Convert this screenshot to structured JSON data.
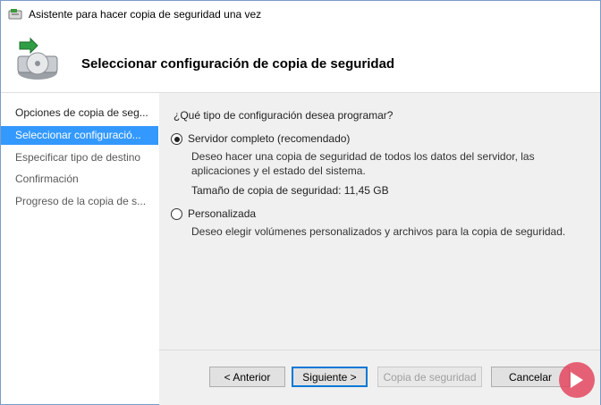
{
  "window": {
    "title": "Asistente para hacer copia de seguridad una vez"
  },
  "header": {
    "title": "Seleccionar configuración de copia de seguridad"
  },
  "sidebar": {
    "items": [
      {
        "label": "Opciones de copia de seg..."
      },
      {
        "label": "Seleccionar configuració..."
      },
      {
        "label": "Especificar tipo de destino"
      },
      {
        "label": "Confirmación"
      },
      {
        "label": "Progreso de la copia de s..."
      }
    ]
  },
  "main": {
    "question": "¿Qué tipo de configuración desea programar?",
    "options": [
      {
        "label": "Servidor completo (recomendado)",
        "description": "Deseo hacer una copia de seguridad de todos los datos del servidor, las aplicaciones y el estado del sistema.",
        "size_text": "Tamaño de copia de seguridad: 11,45 GB",
        "selected": true
      },
      {
        "label": "Personalizada",
        "description": "Deseo elegir volúmenes personalizados y archivos para la copia de seguridad.",
        "selected": false
      }
    ]
  },
  "buttons": {
    "back": "< Anterior",
    "next": "Siguiente >",
    "backup": "Copia de seguridad",
    "cancel": "Cancelar"
  },
  "colors": {
    "selection": "#3399ff",
    "accent": "#0078d7",
    "watermark": "#e4475f"
  },
  "icons": {
    "title": "backup-window-icon",
    "header": "backup-disk-icon",
    "watermark": "brand-logo-icon"
  }
}
